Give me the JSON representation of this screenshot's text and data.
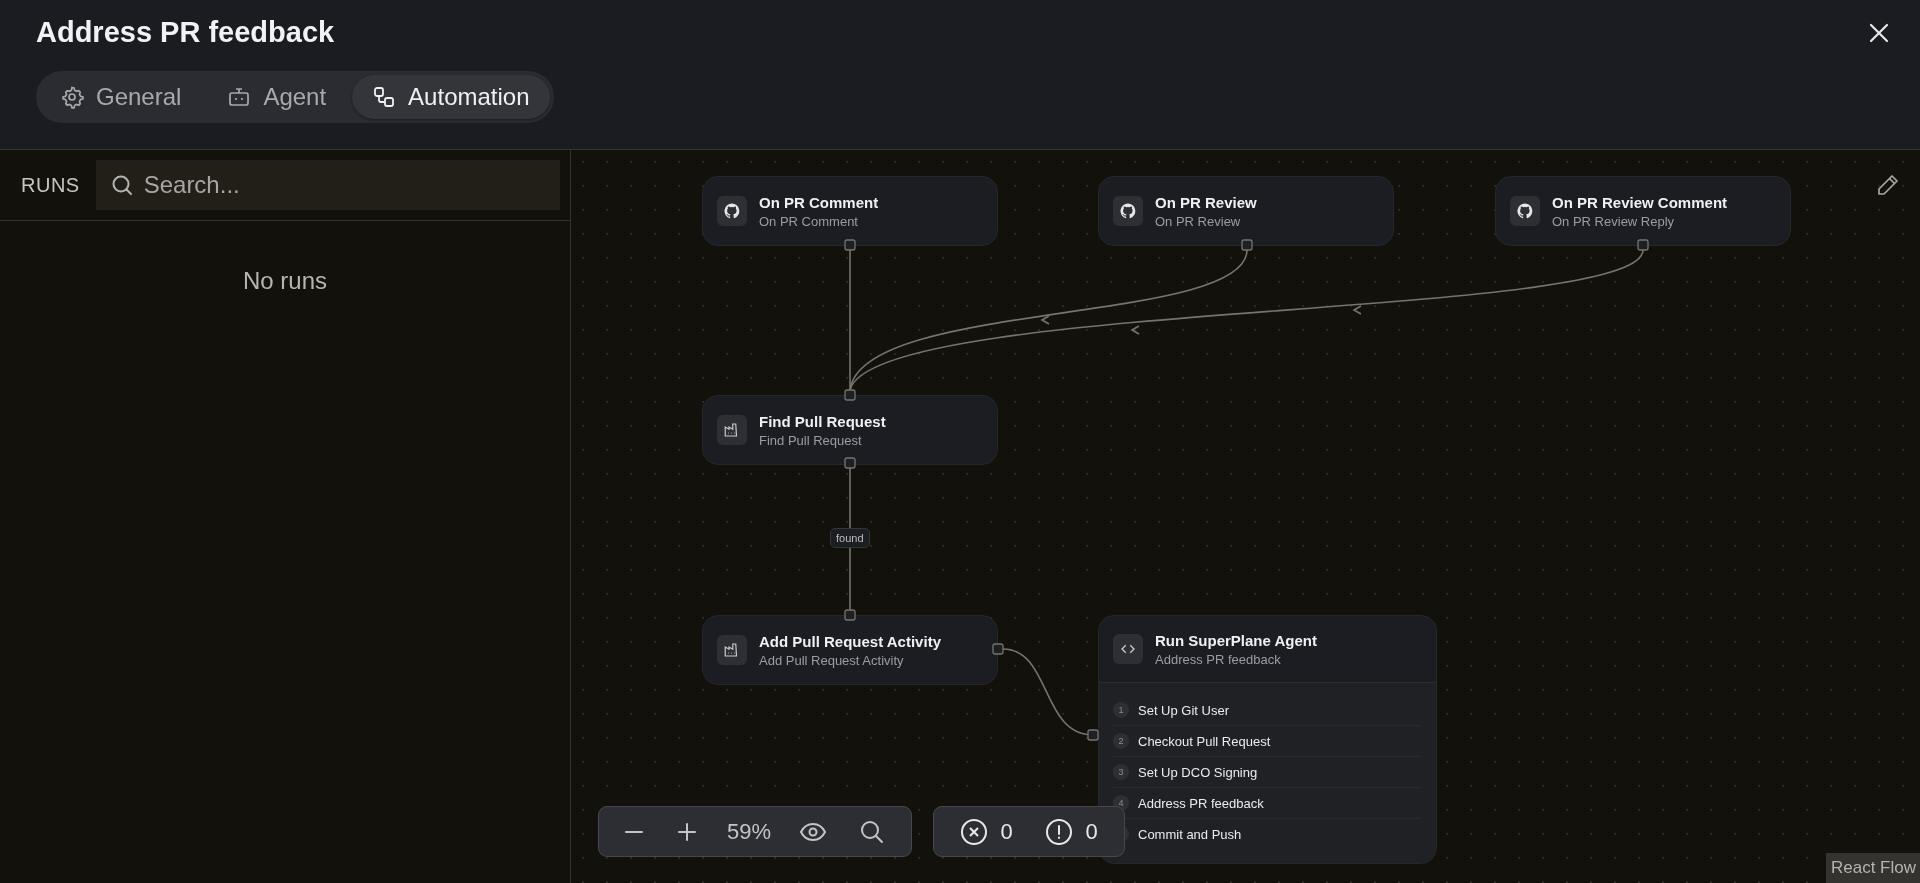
{
  "dialog": {
    "title": "Address PR feedback"
  },
  "tabs": [
    {
      "kind": "gear",
      "label": "General",
      "selected": false
    },
    {
      "kind": "robot",
      "label": "Agent",
      "selected": false
    },
    {
      "kind": "flow",
      "label": "Automation",
      "selected": true
    }
  ],
  "runs": {
    "heading": "RUNS",
    "search": {
      "placeholder": "Search..."
    },
    "empty": "No runs"
  },
  "nodes": [
    {
      "kind": "trigger",
      "title": "On PR Comment",
      "subtitle": "On PR Comment"
    },
    {
      "kind": "trigger",
      "title": "On PR Review",
      "subtitle": "On PR Review"
    },
    {
      "kind": "trigger",
      "title": "On PR Review Comment",
      "subtitle": "On PR Review Reply"
    },
    {
      "kind": "action",
      "title": "Find Pull Request",
      "subtitle": "Find Pull Request"
    },
    {
      "kind": "action",
      "title": "Add Pull Request Activity",
      "subtitle": "Add Pull Request Activity"
    },
    {
      "kind": "agent",
      "title": "Run SuperPlane Agent",
      "subtitle": "Address PR feedback",
      "steps": [
        {
          "number": "1",
          "label": "Set Up Git User"
        },
        {
          "number": "2",
          "label": "Checkout Pull Request"
        },
        {
          "number": "3",
          "label": "Set Up DCO Signing"
        },
        {
          "number": "4",
          "label": "Address PR feedback"
        },
        {
          "label": "Commit and Push"
        }
      ]
    }
  ],
  "edge_label": "found",
  "zoom_controls": {
    "zoom": "59%"
  },
  "issues": {
    "errors": "0",
    "warnings": "0"
  },
  "attribution": "React Flow"
}
